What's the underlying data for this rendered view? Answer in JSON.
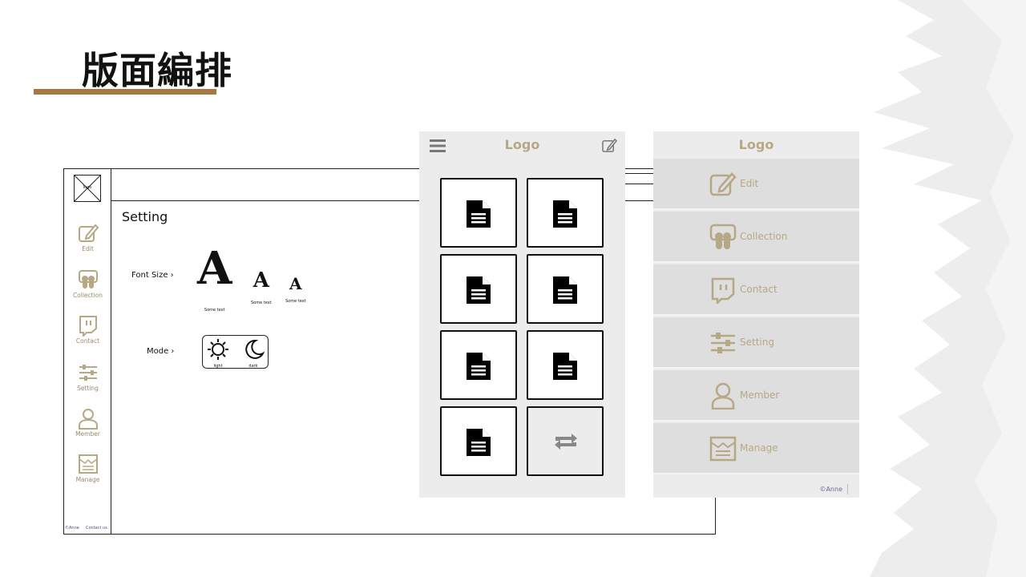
{
  "slide": {
    "title": "版面編排",
    "accent_color": "#a8773f"
  },
  "desktop": {
    "logo_label": "logo",
    "nav": [
      {
        "label": "Edit",
        "icon": "edit-icon"
      },
      {
        "label": "Collection",
        "icon": "collection-icon"
      },
      {
        "label": "Contact",
        "icon": "contact-icon"
      },
      {
        "label": "Setting",
        "icon": "setting-icon"
      },
      {
        "label": "Member",
        "icon": "member-icon"
      },
      {
        "label": "Manage",
        "icon": "manage-icon"
      }
    ],
    "footer_copyright": "©Anne",
    "footer_contact": "Contact us",
    "page_title": "Setting",
    "font_size_label": "Font Size ›",
    "font_size_options": [
      {
        "glyph": "A",
        "caption": "Some text"
      },
      {
        "glyph": "A",
        "caption": "Some text"
      },
      {
        "glyph": "A",
        "caption": "Some text"
      }
    ],
    "mode_label": "Mode ›",
    "mode_options": [
      {
        "caption": "light",
        "icon": "sun-icon"
      },
      {
        "caption": "dark",
        "icon": "moon-icon"
      }
    ]
  },
  "mobile": {
    "logo": "Logo",
    "menu_icon": "hamburger-icon",
    "edit_icon": "edit-icon",
    "tiles": [
      "document-icon",
      "document-icon",
      "document-icon",
      "document-icon",
      "document-icon",
      "document-icon",
      "document-icon",
      "refresh-icon"
    ]
  },
  "menu": {
    "logo": "Logo",
    "items": [
      {
        "label": "Edit",
        "icon": "edit-icon"
      },
      {
        "label": "Collection",
        "icon": "collection-icon"
      },
      {
        "label": "Contact",
        "icon": "contact-icon"
      },
      {
        "label": "Setting",
        "icon": "setting-icon"
      },
      {
        "label": "Member",
        "icon": "member-icon"
      },
      {
        "label": "Manage",
        "icon": "manage-icon"
      }
    ],
    "footer": "©Anne"
  },
  "colors": {
    "gold": "#b7a884",
    "panel_bg": "#ececec",
    "menu_item_bg": "#dedede"
  }
}
